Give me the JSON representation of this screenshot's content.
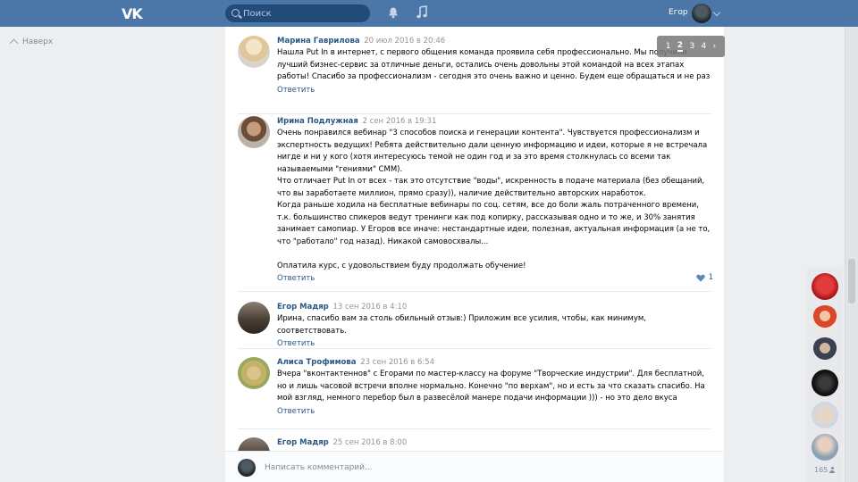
{
  "header": {
    "logo": "VK",
    "search_placeholder": "Поиск",
    "user_name": "Егор",
    "icons": [
      "vk-logo-icon",
      "search-icon",
      "bell-icon",
      "music-icon",
      "chevron-down-icon"
    ]
  },
  "nav": {
    "back_label": "Наверх"
  },
  "pager": {
    "pages": [
      "1",
      "2",
      "3",
      "4"
    ],
    "current": "2",
    "next": "›"
  },
  "comments": [
    {
      "author": "Марина Гаврилова",
      "date": "20 июл 2016 в 20:46",
      "text": "Нашла Put In в интернет, с первого общения команда проявила себя профессионально. Мы получили лучший бизнес-сервис за отличные деньги, остались очень довольны этой командой на всех этапах работы! Спасибо за профессионализм - сегодня это очень важно и ценно. Будем еще обращаться и не раз",
      "reply": "Ответить"
    },
    {
      "author": "Ирина Подлужная",
      "date": "2 сен 2016 в 19:31",
      "text": "Очень понравился вебинар \"3 способов поиска и генерации контента\". Чувствуется профессионализм и экспертность ведущих! Ребята действительно дали ценную информацию и идеи, которые я не встречала нигде и ни у кого (хотя интересуюсь темой не один год и за это время столкнулась со всеми так называемыми \"гениями\" СММ).\nЧто отличает Put In от всех - так это отсутствие \"воды\", искренность в подаче материала (без обещаний, что вы заработаете миллион, прямо сразу)), наличие действительно авторских наработок.\nКогда раньше ходила на бесплатные вебинары по соц. сетям, все до боли жаль потраченного времени, т.к. большинство спикеров ведут тренинги как под копирку, рассказывая одно и то же, и 30% занятия занимает самопиар. У Егоров все иначе: нестандартные идеи, полезная, актуальная информация (а не то, что \"работало\" год назад). Никакой самовосхвалы...\n\nОплатила курс, с удовольствием буду продолжать обучение!",
      "reply": "Ответить",
      "likes": "1"
    },
    {
      "author": "Егор Мадяр",
      "date": "13 сен 2016 в 4:10",
      "text": "Ирина, спасибо вам за столь обильный отзыв:) Приложим все усилия, чтобы, как минимум, соответствовать.",
      "reply": "Ответить"
    },
    {
      "author": "Алиса Трофимова",
      "date": "23 сен 2016 в 6:54",
      "text": "Вчера \"вконтактеннов\" с Егорами по мастер-классу на форуме \"Творческие индустрии\". Для бесплатной, но и лишь часовой встречи вполне нормально. Конечно \"по верхам\", но и есть за что сказать спасибо. На мой взгляд, немного перебор был в развесёлой манере подачи информации ))) - но это дело вкуса",
      "reply": "Ответить"
    },
    {
      "author": "Егор Мадяр",
      "date": "25 сен 2016 в 8:00",
      "text": "",
      "reply": ""
    }
  ],
  "composer": {
    "placeholder": "Написать комментарий..."
  },
  "sidebar": {
    "online_count": "165"
  },
  "colors": {
    "header": "#4a76a8",
    "link": "#2a5885",
    "date": "#939393"
  }
}
